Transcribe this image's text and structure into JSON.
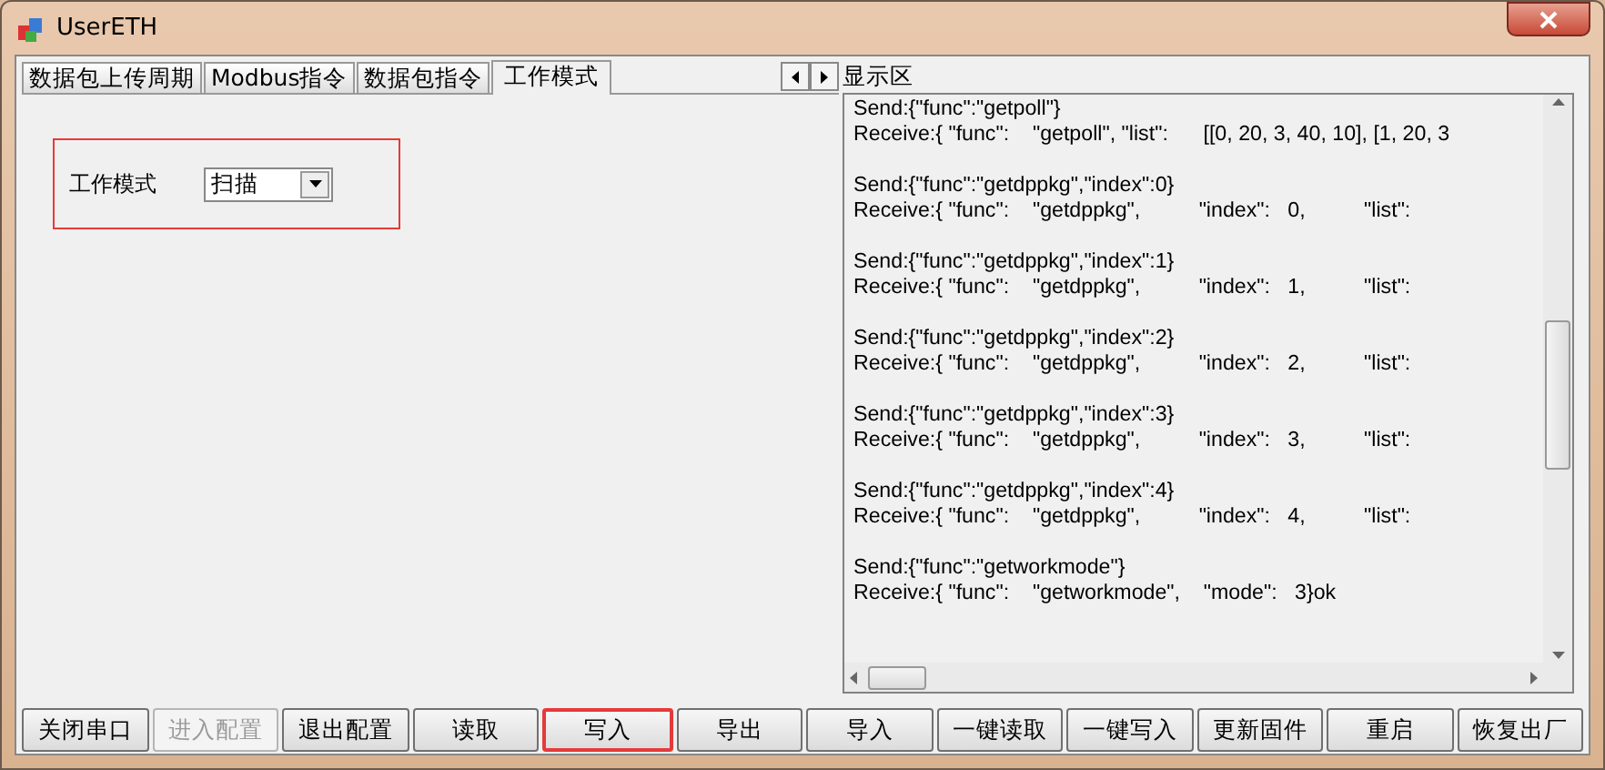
{
  "window": {
    "title": "UserETH"
  },
  "tabs": [
    {
      "label": "数据包上传周期",
      "selected": false
    },
    {
      "label": "Modbus指令",
      "selected": false
    },
    {
      "label": "数据包指令",
      "selected": false
    },
    {
      "label": "工作模式",
      "selected": true
    }
  ],
  "work_mode": {
    "highlighted": true,
    "label": "工作模式",
    "value": "扫描"
  },
  "display": {
    "title": "显示区",
    "entries": [
      {
        "send": "Send:{\"func\":\"getpoll\"}",
        "receive": "Receive:{ \"func\":    \"getpoll\", \"list\":      [[0, 20, 3, 40, 10], [1, 20, 3"
      },
      {
        "send": "Send:{\"func\":\"getdppkg\",\"index\":0}",
        "receive": "Receive:{ \"func\":    \"getdppkg\",          \"index\":   0,          \"list\":"
      },
      {
        "send": "Send:{\"func\":\"getdppkg\",\"index\":1}",
        "receive": "Receive:{ \"func\":    \"getdppkg\",          \"index\":   1,          \"list\":"
      },
      {
        "send": "Send:{\"func\":\"getdppkg\",\"index\":2}",
        "receive": "Receive:{ \"func\":    \"getdppkg\",          \"index\":   2,          \"list\":"
      },
      {
        "send": "Send:{\"func\":\"getdppkg\",\"index\":3}",
        "receive": "Receive:{ \"func\":    \"getdppkg\",          \"index\":   3,          \"list\":"
      },
      {
        "send": "Send:{\"func\":\"getdppkg\",\"index\":4}",
        "receive": "Receive:{ \"func\":    \"getdppkg\",          \"index\":   4,          \"list\":"
      },
      {
        "send": "Send:{\"func\":\"getworkmode\"}",
        "receive": "Receive:{ \"func\":    \"getworkmode\",    \"mode\":   3}ok"
      }
    ]
  },
  "buttons": [
    {
      "label": "关闭串口",
      "disabled": false,
      "highlighted": false
    },
    {
      "label": "进入配置",
      "disabled": true,
      "highlighted": false
    },
    {
      "label": "退出配置",
      "disabled": false,
      "highlighted": false
    },
    {
      "label": "读取",
      "disabled": false,
      "highlighted": false
    },
    {
      "label": "写入",
      "disabled": false,
      "highlighted": true
    },
    {
      "label": "导出",
      "disabled": false,
      "highlighted": false
    },
    {
      "label": "导入",
      "disabled": false,
      "highlighted": false
    },
    {
      "label": "一键读取",
      "disabled": false,
      "highlighted": false
    },
    {
      "label": "一键写入",
      "disabled": false,
      "highlighted": false
    },
    {
      "label": "更新固件",
      "disabled": false,
      "highlighted": false
    },
    {
      "label": "重启",
      "disabled": false,
      "highlighted": false
    },
    {
      "label": "恢复出厂",
      "disabled": false,
      "highlighted": false
    }
  ]
}
